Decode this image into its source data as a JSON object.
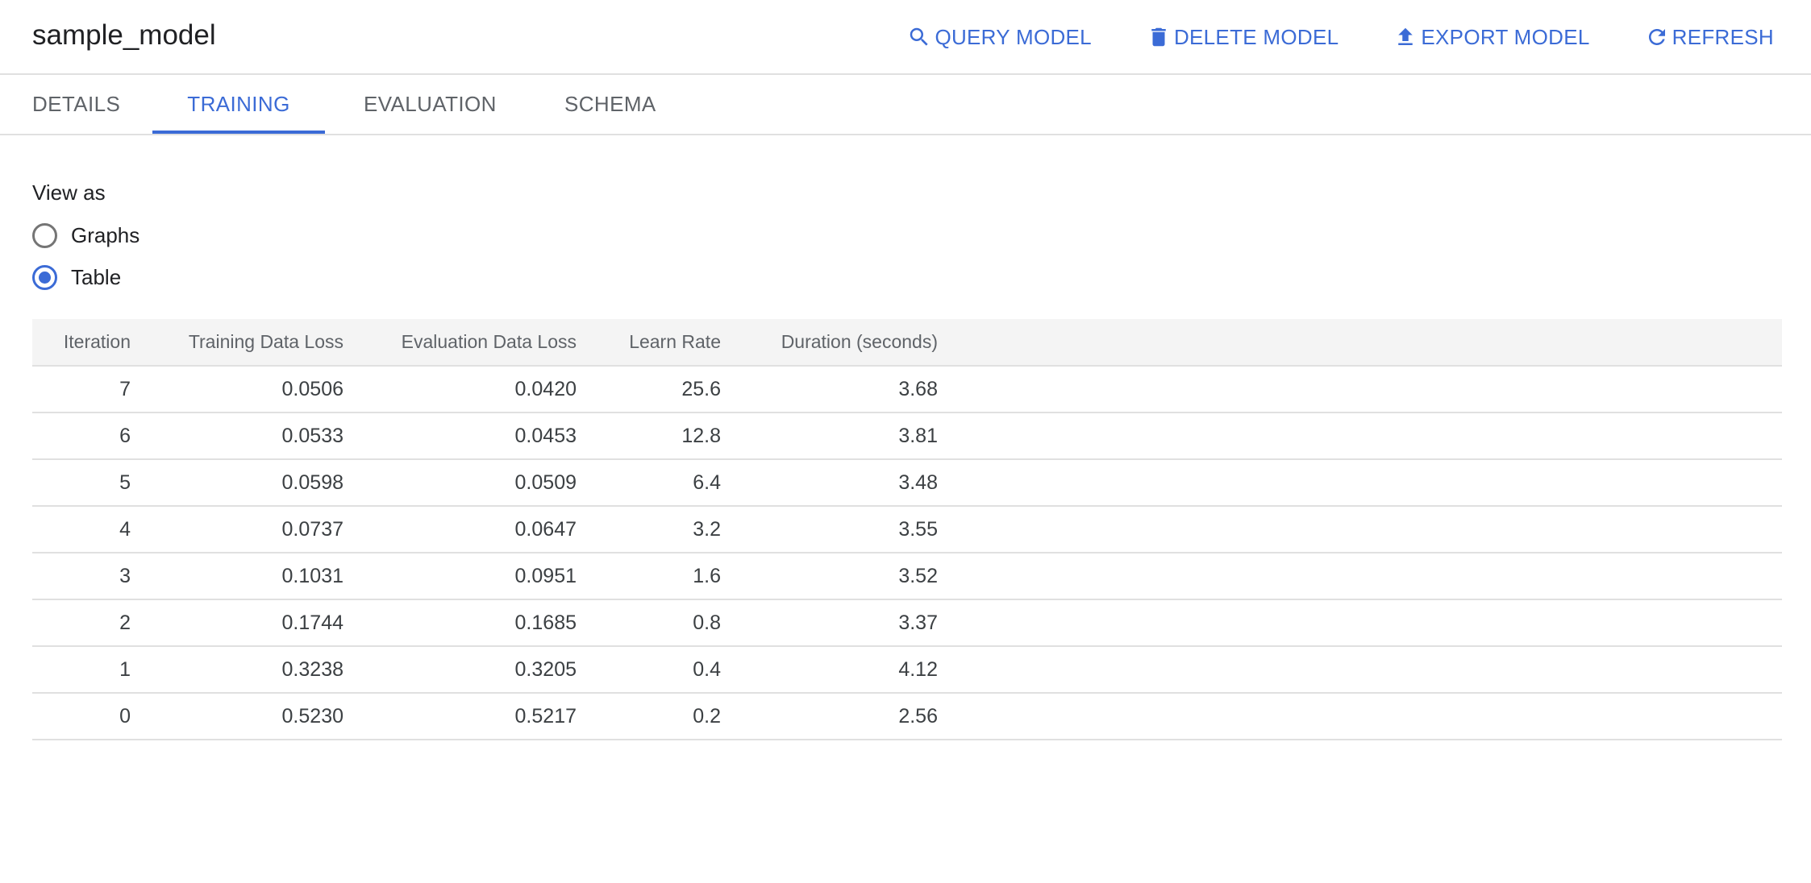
{
  "header": {
    "title": "sample_model",
    "actions": [
      {
        "label": "QUERY MODEL",
        "icon": "search-icon"
      },
      {
        "label": "DELETE MODEL",
        "icon": "trash-icon"
      },
      {
        "label": "EXPORT MODEL",
        "icon": "export-icon"
      },
      {
        "label": "REFRESH",
        "icon": "refresh-icon"
      }
    ]
  },
  "tabs": [
    {
      "label": "DETAILS",
      "active": false
    },
    {
      "label": "TRAINING",
      "active": true
    },
    {
      "label": "EVALUATION",
      "active": false
    },
    {
      "label": "SCHEMA",
      "active": false
    }
  ],
  "view_as": {
    "label": "View as",
    "options": [
      {
        "label": "Graphs",
        "checked": false
      },
      {
        "label": "Table",
        "checked": true
      }
    ]
  },
  "table": {
    "columns": [
      "Iteration",
      "Training Data Loss",
      "Evaluation Data Loss",
      "Learn Rate",
      "Duration (seconds)"
    ],
    "rows": [
      [
        "7",
        "0.0506",
        "0.0420",
        "25.6",
        "3.68"
      ],
      [
        "6",
        "0.0533",
        "0.0453",
        "12.8",
        "3.81"
      ],
      [
        "5",
        "0.0598",
        "0.0509",
        "6.4",
        "3.48"
      ],
      [
        "4",
        "0.0737",
        "0.0647",
        "3.2",
        "3.55"
      ],
      [
        "3",
        "0.1031",
        "0.0951",
        "1.6",
        "3.52"
      ],
      [
        "2",
        "0.1744",
        "0.1685",
        "0.8",
        "3.37"
      ],
      [
        "1",
        "0.3238",
        "0.3205",
        "0.4",
        "4.12"
      ],
      [
        "0",
        "0.5230",
        "0.5217",
        "0.2",
        "2.56"
      ]
    ]
  },
  "colors": {
    "accent": "#3b6bd6",
    "text": "#202124",
    "muted": "#5f6368",
    "divider": "#e0e0e0",
    "header_bg": "#f4f4f4"
  }
}
